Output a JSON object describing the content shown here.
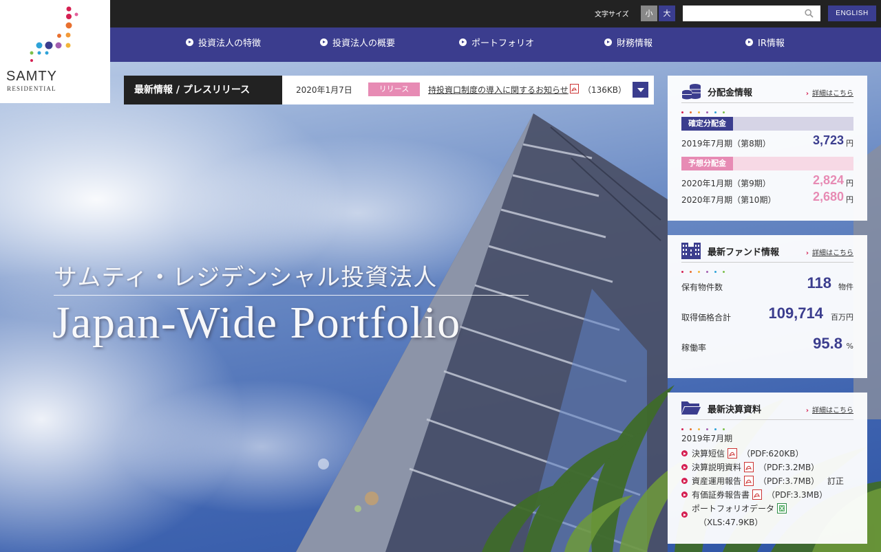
{
  "logo": {
    "name": "SAMTY",
    "sub": "RESIDENTIAL"
  },
  "topbar": {
    "font_size_label": "文字サイズ",
    "font_small": "小",
    "font_large": "大",
    "search_placeholder": "",
    "english_label": "ENGLISH"
  },
  "nav": {
    "items": [
      {
        "label": "投資法人の特徴"
      },
      {
        "label": "投資法人の概要"
      },
      {
        "label": "ポートフォリオ"
      },
      {
        "label": "財務情報"
      },
      {
        "label": "IR情報"
      }
    ]
  },
  "news": {
    "section_label": "最新情報 / プレスリリース",
    "date": "2020年1月7日",
    "badge": "リリース",
    "title": "持投資口制度の導入に関するお知らせ",
    "size": "（136KB）"
  },
  "hero": {
    "jp": "サムティ・レジデンシャル投資法人",
    "en": "Japan-Wide Portfolio"
  },
  "distribution": {
    "title": "分配金情報",
    "more": "詳細はこちら",
    "fixed_label": "確定分配金",
    "fixed_rows": [
      {
        "period": "2019年7月期（第8期）",
        "value": "3,723",
        "unit": "円"
      }
    ],
    "forecast_label": "予想分配金",
    "forecast_rows": [
      {
        "period": "2020年1月期（第9期）",
        "value": "2,824",
        "unit": "円"
      },
      {
        "period": "2020年7月期（第10期）",
        "value": "2,680",
        "unit": "円"
      }
    ]
  },
  "fund": {
    "title": "最新ファンド情報",
    "more": "詳細はこちら",
    "rows": [
      {
        "label": "保有物件数",
        "value": "118",
        "unit": "物件"
      },
      {
        "label": "取得価格合計",
        "value": "109,714",
        "unit": "百万円"
      },
      {
        "label": "稼働率",
        "value": "95.8",
        "unit": "%"
      }
    ]
  },
  "reports": {
    "title": "最新決算資料",
    "more": "詳細はこちら",
    "period": "2019年7月期",
    "items": [
      {
        "label": "決算短信",
        "size": "（PDF:620KB）",
        "extra": ""
      },
      {
        "label": "決算説明資料",
        "size": "（PDF:3.2MB）",
        "extra": ""
      },
      {
        "label": "資産運用報告",
        "size": "（PDF:3.7MB）",
        "extra": "訂正"
      },
      {
        "label": "有価証券報告書",
        "size": "（PDF:3.3MB）",
        "extra": ""
      },
      {
        "label": "ポートフォリオデータ",
        "size": "（XLS:47.9KB）",
        "extra": ""
      }
    ]
  },
  "colors": {
    "brand_navy": "#3b3d8e",
    "brand_pink": "#e78bb4",
    "accent_red": "#d52052",
    "topbar": "#222222"
  }
}
